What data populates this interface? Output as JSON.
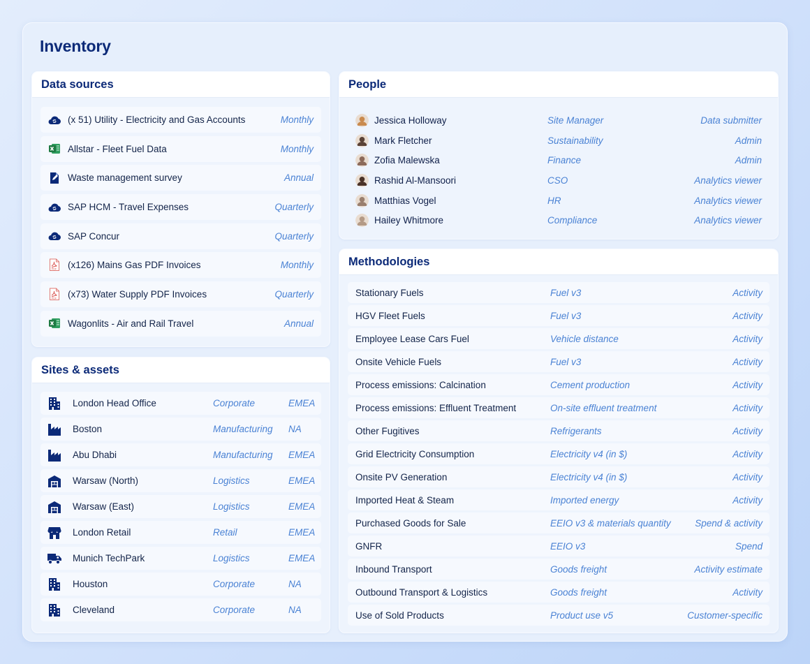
{
  "page": {
    "title": "Inventory"
  },
  "data_sources": {
    "title": "Data sources",
    "items": [
      {
        "icon": "cloud-sync-icon",
        "name": "(x 51) Utility - Electricity and Gas Accounts",
        "frequency": "Monthly"
      },
      {
        "icon": "excel-icon",
        "name": "Allstar - Fleet Fuel Data",
        "frequency": "Monthly"
      },
      {
        "icon": "survey-icon",
        "name": "Waste management survey",
        "frequency": "Annual"
      },
      {
        "icon": "cloud-sync-icon",
        "name": "SAP HCM - Travel Expenses",
        "frequency": "Quarterly"
      },
      {
        "icon": "cloud-sync-icon",
        "name": "SAP Concur",
        "frequency": "Quarterly"
      },
      {
        "icon": "pdf-icon",
        "name": "(x126) Mains Gas PDF Invoices",
        "frequency": "Monthly"
      },
      {
        "icon": "pdf-icon",
        "name": "(x73) Water Supply PDF Invoices",
        "frequency": "Quarterly"
      },
      {
        "icon": "excel-icon",
        "name": "Wagonlits - Air and Rail Travel",
        "frequency": "Annual"
      }
    ]
  },
  "sites": {
    "title": "Sites & assets",
    "items": [
      {
        "icon": "office-building-icon",
        "name": "London Head Office",
        "type": "Corporate",
        "region": "EMEA"
      },
      {
        "icon": "factory-icon",
        "name": "Boston",
        "type": "Manufacturing",
        "region": "NA"
      },
      {
        "icon": "factory-icon",
        "name": "Abu Dhabi",
        "type": "Manufacturing",
        "region": "EMEA"
      },
      {
        "icon": "warehouse-icon",
        "name": "Warsaw (North)",
        "type": "Logistics",
        "region": "EMEA"
      },
      {
        "icon": "warehouse-icon",
        "name": "Warsaw (East)",
        "type": "Logistics",
        "region": "EMEA"
      },
      {
        "icon": "store-icon",
        "name": "London Retail",
        "type": "Retail",
        "region": "EMEA"
      },
      {
        "icon": "truck-icon",
        "name": "Munich TechPark",
        "type": "Logistics",
        "region": "EMEA"
      },
      {
        "icon": "office-building-icon",
        "name": "Houston",
        "type": "Corporate",
        "region": "NA"
      },
      {
        "icon": "office-building-icon",
        "name": "Cleveland",
        "type": "Corporate",
        "region": "NA"
      }
    ]
  },
  "people": {
    "title": "People",
    "items": [
      {
        "name": "Jessica Holloway",
        "role": "Site Manager",
        "permission": "Data submitter",
        "avatar_color": "#c98a4e"
      },
      {
        "name": "Mark Fletcher",
        "role": "Sustainability",
        "permission": "Admin",
        "avatar_color": "#5a4236"
      },
      {
        "name": "Zofia Malewska",
        "role": "Finance",
        "permission": "Admin",
        "avatar_color": "#8c6a5a"
      },
      {
        "name": "Rashid Al-Mansoori",
        "role": "CSO",
        "permission": "Analytics viewer",
        "avatar_color": "#4a3228"
      },
      {
        "name": "Matthias Vogel",
        "role": "HR",
        "permission": "Analytics viewer",
        "avatar_color": "#9a7f6e"
      },
      {
        "name": "Hailey Whitmore",
        "role": "Compliance",
        "permission": "Analytics viewer",
        "avatar_color": "#b49a86"
      }
    ]
  },
  "methodologies": {
    "title": "Methodologies",
    "items": [
      {
        "name": "Stationary Fuels",
        "method": "Fuel v3",
        "kind": "Activity"
      },
      {
        "name": "HGV Fleet Fuels",
        "method": "Fuel v3",
        "kind": "Activity"
      },
      {
        "name": "Employee Lease Cars Fuel",
        "method": "Vehicle distance",
        "kind": "Activity"
      },
      {
        "name": "Onsite Vehicle Fuels",
        "method": "Fuel v3",
        "kind": "Activity"
      },
      {
        "name": "Process emissions: Calcination",
        "method": "Cement production",
        "kind": "Activity"
      },
      {
        "name": "Process emissions: Effluent Treatment",
        "method": "On-site effluent treatment",
        "kind": "Activity"
      },
      {
        "name": "Other Fugitives",
        "method": "Refrigerants",
        "kind": "Activity"
      },
      {
        "name": "Grid Electricity Consumption",
        "method": "Electricity v4 (in $)",
        "kind": "Activity"
      },
      {
        "name": "Onsite PV Generation",
        "method": "Electricity v4 (in $)",
        "kind": "Activity"
      },
      {
        "name": "Imported Heat & Steam",
        "method": "Imported energy",
        "kind": "Activity"
      },
      {
        "name": "Purchased Goods for Sale",
        "method": "EEIO v3 & materials quantity",
        "kind": "Spend & activity"
      },
      {
        "name": "GNFR",
        "method": "EEIO v3",
        "kind": "Spend"
      },
      {
        "name": "Inbound Transport",
        "method": "Goods freight",
        "kind": "Activity estimate"
      },
      {
        "name": "Outbound Transport & Logistics",
        "method": "Goods freight",
        "kind": "Activity"
      },
      {
        "name": "Use of Sold Products",
        "method": "Product use v5",
        "kind": "Customer-specific"
      }
    ]
  },
  "colors": {
    "brand_dark": "#0c2a78",
    "accent_italic": "#4a82d4",
    "excel_green": "#1f7a43",
    "pdf_red": "#d9534f"
  }
}
